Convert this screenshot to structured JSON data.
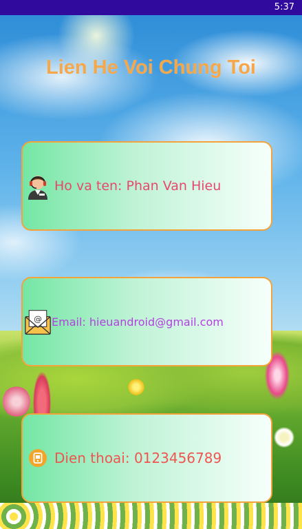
{
  "status_bar": {
    "time": "5:37"
  },
  "page": {
    "title": "Lien He Voi Chung Toi"
  },
  "contacts": {
    "name": {
      "icon": "support-agent-icon",
      "text": "Ho va ten: Phan Van Hieu"
    },
    "email": {
      "icon": "envelope-email-icon",
      "text": "Email: hieuandroid@gmail.com"
    },
    "phone": {
      "icon": "phone-icon",
      "text": "Dien thoai: 0123456789"
    }
  },
  "colors": {
    "status_bar": "#2f0a9c",
    "title": "#f5a74a",
    "card_border": "#f3a33a",
    "name_text": "#e5486c",
    "email_text": "#b340e0",
    "phone_text": "#ef5550"
  }
}
